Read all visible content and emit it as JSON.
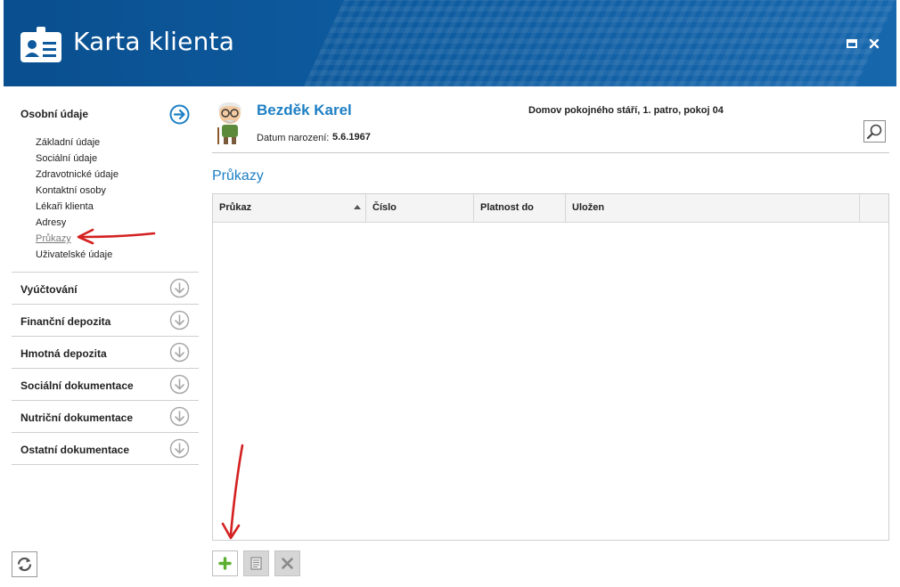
{
  "window": {
    "title": "Karta klienta",
    "icons": {
      "app": "id-card-icon",
      "maximize": "maximize-icon",
      "close": "close-icon"
    }
  },
  "sidebar": {
    "open_section": {
      "title": "Osobní údaje",
      "icon": "arrow-right-circle-icon",
      "items": [
        {
          "label": "Základní údaje"
        },
        {
          "label": "Sociální údaje"
        },
        {
          "label": "Zdravotnické údaje"
        },
        {
          "label": "Kontaktní osoby"
        },
        {
          "label": "Lékaři klienta"
        },
        {
          "label": "Adresy"
        },
        {
          "label": "Průkazy",
          "active": true
        },
        {
          "label": "Uživatelské údaje"
        }
      ]
    },
    "collapsed_sections": [
      {
        "title": "Vyúčtování"
      },
      {
        "title": "Finanční depozita"
      },
      {
        "title": "Hmotná depozita"
      },
      {
        "title": "Sociální dokumentace"
      },
      {
        "title": "Nutriční dokumentace"
      },
      {
        "title": "Ostatní dokumentace"
      }
    ],
    "collapsed_icon": "arrow-down-circle-icon",
    "refresh_icon": "refresh-icon"
  },
  "client": {
    "name": "Bezděk Karel",
    "dob_label": "Datum narození:",
    "dob": "5.6.1967",
    "location": "Domov pokojného stáří, 1. patro, pokoj 04",
    "avatar_icon": "elderly-man-avatar-icon",
    "search_icon": "magnifier-icon"
  },
  "main": {
    "heading": "Průkazy",
    "grid": {
      "columns": [
        "Průkaz",
        "Číslo",
        "Platnost do",
        "Uložen"
      ],
      "sorted_column": "Průkaz",
      "sort_direction": "ascending",
      "rows": []
    }
  },
  "toolbar": {
    "add_icon": "plus-icon",
    "edit_icon": "document-edit-icon",
    "delete_icon": "delete-x-icon"
  },
  "colors": {
    "header_blue": "#0d5a9e",
    "accent_blue": "#1d7fc4",
    "add_green": "#5bb030",
    "annotation_red": "#d42020"
  }
}
